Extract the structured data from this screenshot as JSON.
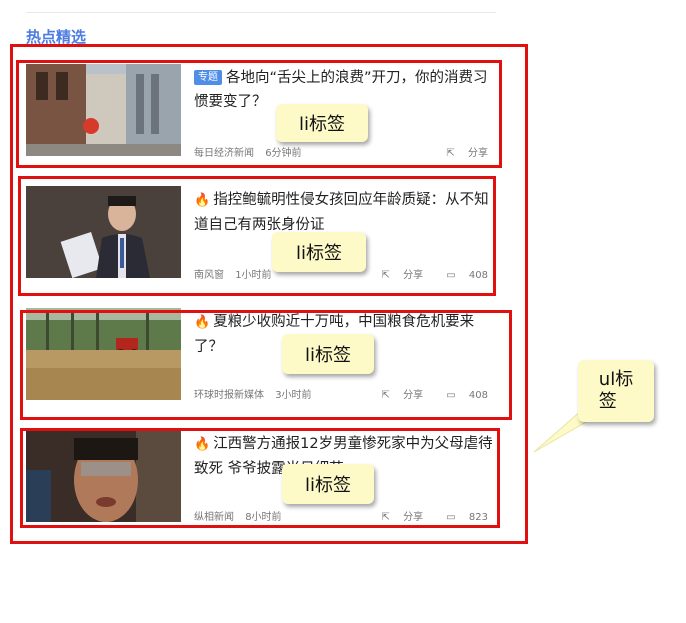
{
  "section": {
    "title": "热点精选"
  },
  "items": [
    {
      "tag": "专题",
      "title": "各地向“舌尖上的浪费”开刀，你的消费习惯要变了？",
      "source": "每日经济新闻",
      "time": "6分钟前",
      "share": "分享",
      "comments": ""
    },
    {
      "title": "指控鲍毓明性侵女孩回应年龄质疑：从不知道自己有两张身份证",
      "source": "南风窗",
      "time": "1小时前",
      "share": "分享",
      "comments": "408"
    },
    {
      "title": "夏粮少收购近十万吨，中国粮食危机要来了？",
      "source": "环球时报新媒体",
      "time": "3小时前",
      "share": "分享",
      "comments": "408"
    },
    {
      "title": "江西警方通报12岁男童惨死家中为父母虐待致死 爷爷披露当日细节",
      "source": "纵相新闻",
      "time": "8小时前",
      "share": "分享",
      "comments": "823"
    }
  ],
  "annotations": {
    "li_label": "li标签",
    "ul_label": "ul标\n签"
  },
  "icons": {
    "share": "share-icon",
    "comment": "comment-icon",
    "fire": "fire-icon"
  },
  "colors": {
    "accent": "#4e7de2",
    "annotation_border": "#e01010",
    "callout_bg": "#fdfac8"
  }
}
